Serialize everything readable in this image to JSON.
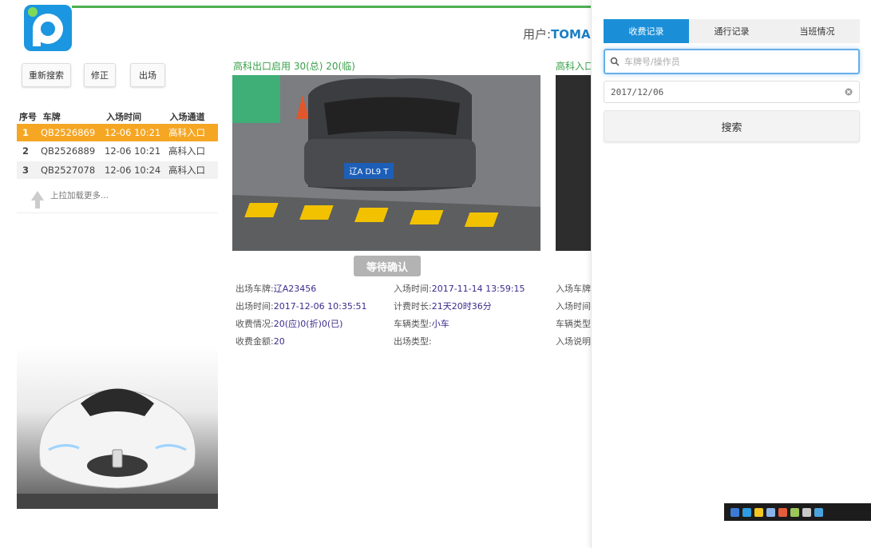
{
  "header": {
    "user_prefix": "用户:",
    "user_name": "TOMA"
  },
  "left_panel": {
    "buttons": [
      "重新搜索",
      "修正",
      "出场"
    ],
    "columns": [
      "序号",
      "车牌",
      "入场时间",
      "入场通道"
    ],
    "rows": [
      {
        "no": "1",
        "plate": "QB2526869",
        "time": "12-06 10:21",
        "gate": "高科入口",
        "selected": true
      },
      {
        "no": "2",
        "plate": "QB2526889",
        "time": "12-06 10:21",
        "gate": "高科入口",
        "selected": false
      },
      {
        "no": "3",
        "plate": "QB2527078",
        "time": "12-06 10:24",
        "gate": "高科入口",
        "selected": false
      }
    ],
    "load_more": "上拉加载更多..."
  },
  "middle_panel": {
    "title": "高科出口启用 30(总) 20(临)",
    "plate_in_photo": "辽A DL9 T",
    "confirm_button": "等待确认",
    "info": {
      "exit_plate_label": "出场车牌:",
      "exit_plate": "辽A23456",
      "entry_time_label": "入场时间:",
      "entry_time": "2017-11-14 13:59:15",
      "exit_time_label": "出场时间:",
      "exit_time": "2017-12-06 10:35:51",
      "duration_label": "计费时长:",
      "duration": "21天20时36分",
      "fee_status_label": "收费情况:",
      "fee_status": "20(应)0(折)0(已)",
      "vehicle_type_label": "车辆类型:",
      "vehicle_type": "小车",
      "fee_amount_label": "收费金额:",
      "fee_amount": "20",
      "exit_type_label": "出场类型:",
      "exit_type": ""
    }
  },
  "second_panel": {
    "title": "高科入口",
    "labels": [
      "入场车牌",
      "入场时间",
      "车辆类型",
      "入场说明"
    ]
  },
  "right_panel": {
    "tabs": [
      "收费记录",
      "通行记录",
      "当班情况"
    ],
    "search_placeholder": "车牌号/操作员",
    "date_value": "2017/12/06",
    "search_button": "搜索"
  },
  "colors": {
    "accent_blue": "#1a8fd8",
    "selected_row": "#f5a623",
    "title_green": "#3aa04a"
  }
}
